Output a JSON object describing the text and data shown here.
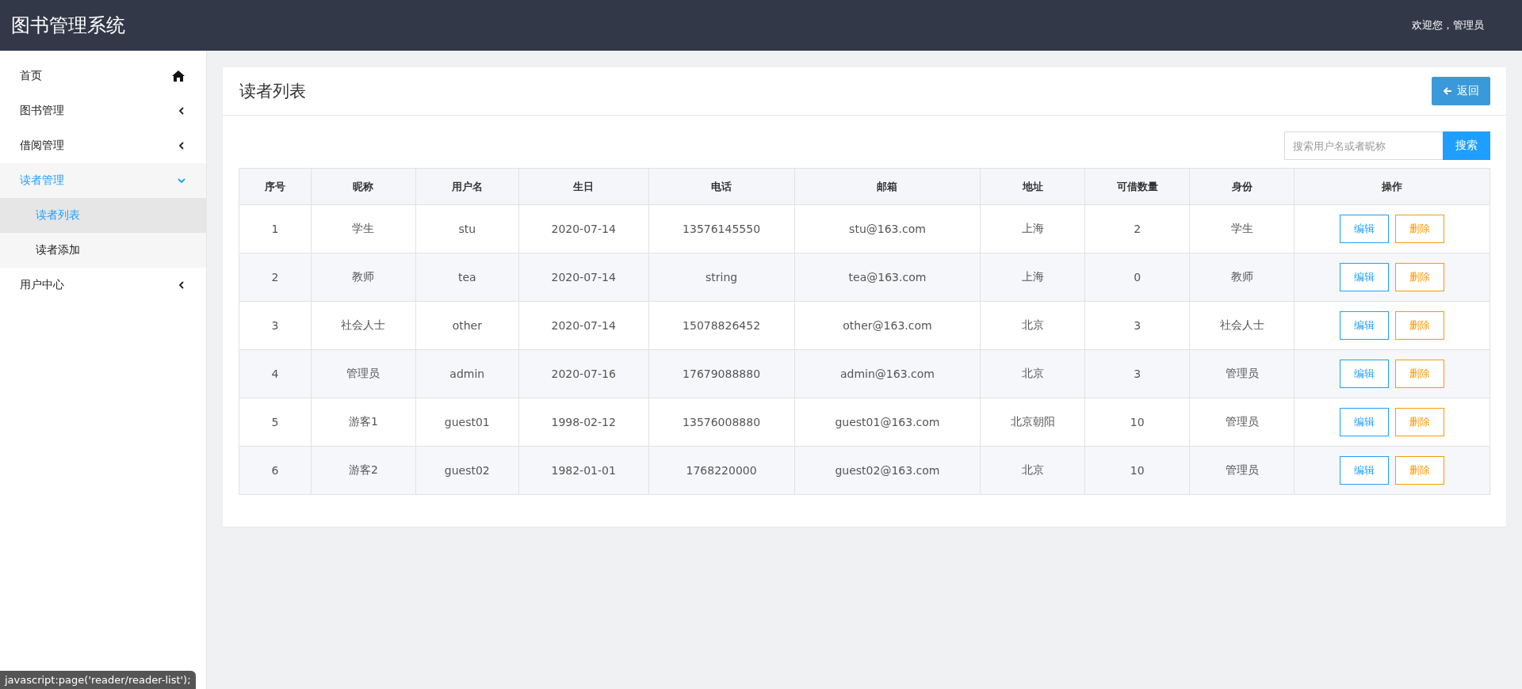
{
  "header": {
    "title": "图书管理系统",
    "welcome": "欢迎您，管理员"
  },
  "sidebar": {
    "items": [
      {
        "label": "首页",
        "kind": "home",
        "selected": false
      },
      {
        "label": "图书管理",
        "kind": "group",
        "selected": false,
        "expanded": false
      },
      {
        "label": "借阅管理",
        "kind": "group",
        "selected": false,
        "expanded": false
      },
      {
        "label": "读者管理",
        "kind": "group",
        "selected": true,
        "expanded": true,
        "children": [
          {
            "label": "读者列表",
            "selected": true
          },
          {
            "label": "读者添加",
            "selected": false
          }
        ]
      },
      {
        "label": "用户中心",
        "kind": "group",
        "selected": false,
        "expanded": false
      }
    ]
  },
  "panel": {
    "title": "读者列表",
    "back_button": "返回",
    "search": {
      "placeholder": "搜索用户名或者昵称",
      "button": "搜索"
    }
  },
  "table": {
    "columns": [
      "序号",
      "昵称",
      "用户名",
      "生日",
      "电话",
      "邮箱",
      "地址",
      "可借数量",
      "身份",
      "操作"
    ],
    "rows": [
      {
        "cells": [
          "1",
          "学生",
          "stu",
          "2020-07-14",
          "13576145550",
          "stu@163.com",
          "上海",
          "2",
          "学生"
        ],
        "actions": [
          "编辑",
          "删除"
        ]
      },
      {
        "cells": [
          "2",
          "教师",
          "tea",
          "2020-07-14",
          "string",
          "tea@163.com",
          "上海",
          "0",
          "教师"
        ],
        "actions": [
          "编辑",
          "删除"
        ]
      },
      {
        "cells": [
          "3",
          "社会人士",
          "other",
          "2020-07-14",
          "15078826452",
          "other@163.com",
          "北京",
          "3",
          "社会人士"
        ],
        "actions": [
          "编辑",
          "删除"
        ]
      },
      {
        "cells": [
          "4",
          "管理员",
          "admin",
          "2020-07-16",
          "17679088880",
          "admin@163.com",
          "北京",
          "3",
          "管理员"
        ],
        "actions": [
          "编辑",
          "删除"
        ]
      },
      {
        "cells": [
          "5",
          "游客1",
          "guest01",
          "1998-02-12",
          "13576008880",
          "guest01@163.com",
          "北京朝阳",
          "10",
          "管理员"
        ],
        "actions": [
          "编辑",
          "删除"
        ]
      },
      {
        "cells": [
          "6",
          "游客2",
          "guest02",
          "1982-01-01",
          "1768220000",
          "guest02@163.com",
          "北京",
          "10",
          "管理员"
        ],
        "actions": [
          "编辑",
          "删除"
        ]
      }
    ]
  },
  "status_bar": {
    "link_preview": "javascript:page('reader/reader-list');"
  }
}
